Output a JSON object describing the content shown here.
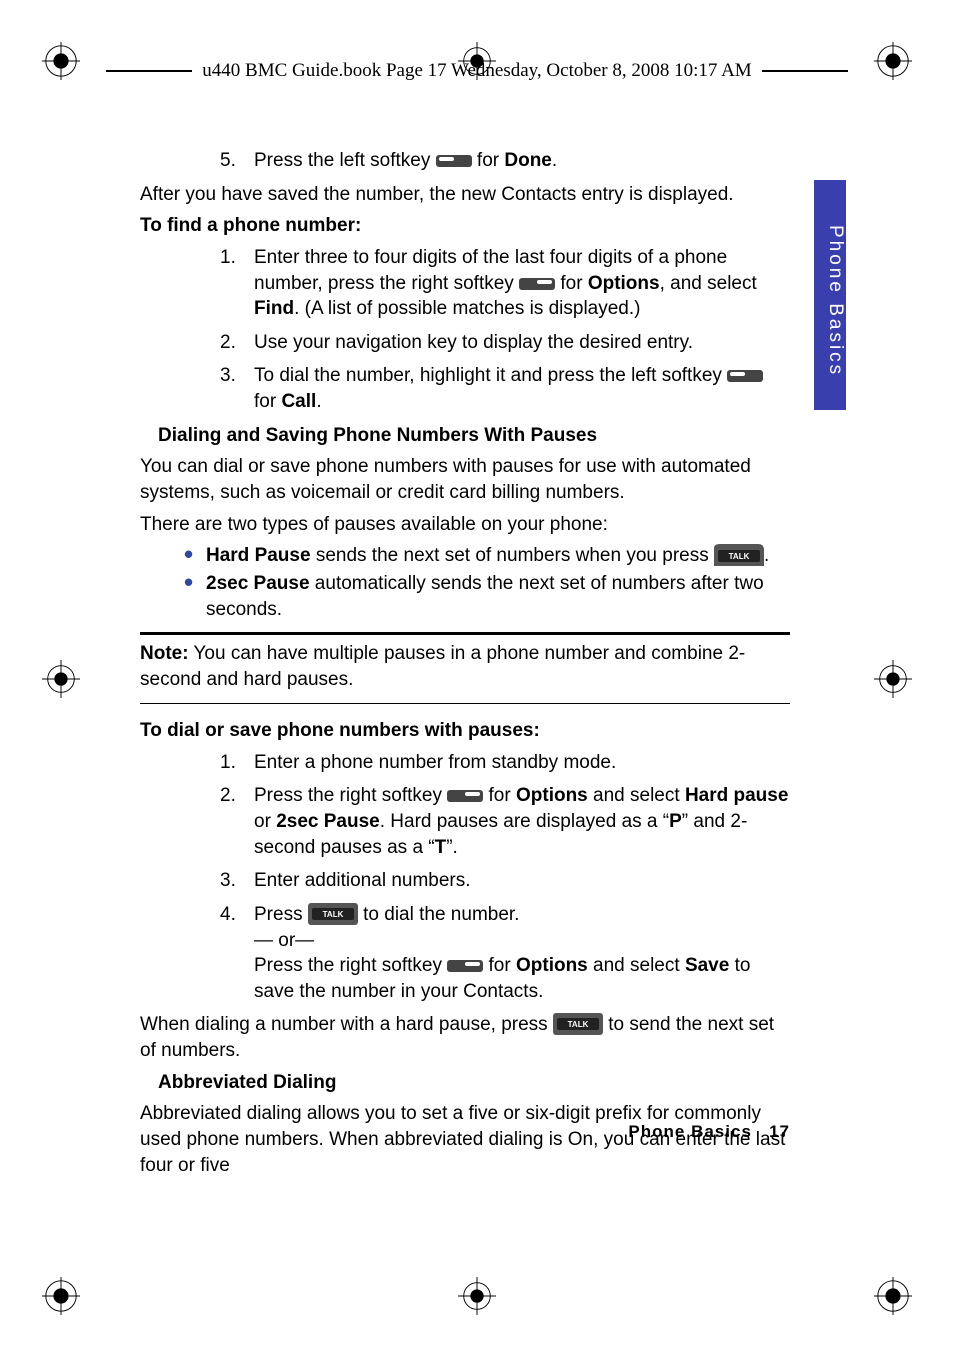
{
  "header": "u440 BMC Guide.book  Page 17  Wednesday, October 8, 2008  10:17 AM",
  "side_tab": "Phone Basics",
  "step5_a": "Press the left softkey ",
  "step5_b": " for ",
  "done": "Done",
  "after_saved": "After you have saved the number, the new Contacts entry is displayed.",
  "find_heading": "To find a phone number:",
  "find1_a": "Enter three to four digits of the last four digits of a phone number, press the right softkey ",
  "find1_b": " for ",
  "options": "Options",
  "find1_c": ", and select ",
  "find": "Find",
  "find1_d": ". (A list of possible matches is displayed.)",
  "find2": "Use your navigation key to display the desired entry.",
  "find3_a": "To dial the number, highlight it and press the left softkey ",
  "find3_b": " for ",
  "call": "Call",
  "dialing_heading": "Dialing and Saving Phone Numbers With Pauses",
  "dialing_p1": "You can dial or save phone numbers with pauses for use with automated systems, such as voicemail or credit card billing numbers.",
  "dialing_p2": "There are two types of pauses available on your phone:",
  "hard_pause": "Hard Pause",
  "hard_pause_txt_a": " sends the next set of numbers when you press ",
  "twosec": "2sec Pause",
  "twosec_txt": " automatically sends the next set of numbers after two seconds.",
  "note_label": "Note:",
  "note_txt": " You can have multiple pauses in a phone number and combine 2-second and hard pauses.",
  "pauses_heading": "To dial or save phone numbers with pauses:",
  "p1": "Enter a phone number from standby mode.",
  "p2_a": "Press the right softkey ",
  "p2_b": " for ",
  "p2_c": " and select ",
  "hardpause2": "Hard pause",
  "p2_d": " or ",
  "twosec2": "2sec Pause",
  "p2_e": ". Hard pauses are displayed as a “",
  "P": "P",
  "p2_f": "” and 2-second pauses as a “",
  "T": "T",
  "p2_g": "”.",
  "p3": "Enter additional numbers.",
  "p4_a": "Press ",
  "p4_b": " to dial the number.",
  "or": "— or—",
  "p4_c": "Press the right softkey ",
  "p4_d": " for ",
  "p4_e": " and select ",
  "save": "Save",
  "p4_f": " to save the number in your Contacts.",
  "when_a": "When dialing a number with a hard pause, press ",
  "when_b": " to send the next set of numbers.",
  "abbrev_heading": "Abbreviated Dialing",
  "abbrev_p": "Abbreviated dialing allows you to set a five or six-digit prefix for commonly used phone numbers. When abbreviated dialing is On, you can enter the last four or five",
  "footer_section": "Phone Basics",
  "footer_page": "17",
  "period": "."
}
